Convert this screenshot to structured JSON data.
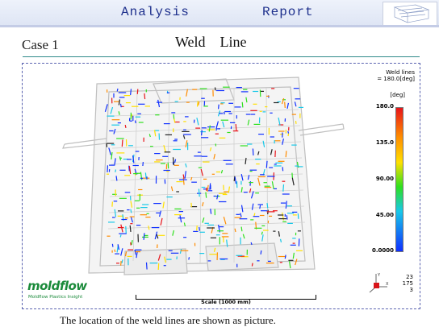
{
  "header": {
    "tabs": [
      "Analysis",
      "Report"
    ]
  },
  "slide": {
    "case_label": "Case 1",
    "title": "Weld    Line",
    "caption": "The location of the weld lines are shown as picture."
  },
  "legend": {
    "title_line1": "Weld lines",
    "title_line2": "= 180.0[deg]",
    "unit": "[deg]",
    "ticks": [
      "180.0",
      "135.0",
      "90.00",
      "45.00",
      "0.0000"
    ],
    "colors": [
      "#e8141a",
      "#ff8c00",
      "#ffe000",
      "#2fe01e",
      "#18c8e8",
      "#1030ff"
    ]
  },
  "axis_triad": {
    "values": [
      "23",
      "175",
      "3"
    ]
  },
  "scale": {
    "label": "Scale (1000 mm)"
  },
  "logo": {
    "name": "moldflow",
    "subtitle": "Moldflow Plastics Insight"
  }
}
